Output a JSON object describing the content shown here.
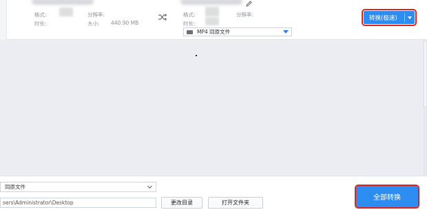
{
  "file_row": {
    "source": {
      "format_label": "格式:",
      "duration_label": "时长:",
      "resolution_label": "分辨率:",
      "size_label": "大小:",
      "size_value": "440.90 MB"
    },
    "target": {
      "format_label": "格式:",
      "duration_label": "时长:",
      "resolution_label": "分辨率:",
      "output_format": "MP4   同原文件"
    },
    "convert_button": {
      "label": "转换(极速)"
    }
  },
  "bottom": {
    "output_format_select": "同原文件",
    "output_path": "sers\\Administrator\\Desktop",
    "change_dir_button": "更改目录",
    "open_folder_button": "打开文件夹",
    "convert_all_button": "全部转换"
  },
  "colors": {
    "accent": "#2d8cf0",
    "highlight_border": "#e0201b",
    "list_background": "#ebedf0"
  }
}
